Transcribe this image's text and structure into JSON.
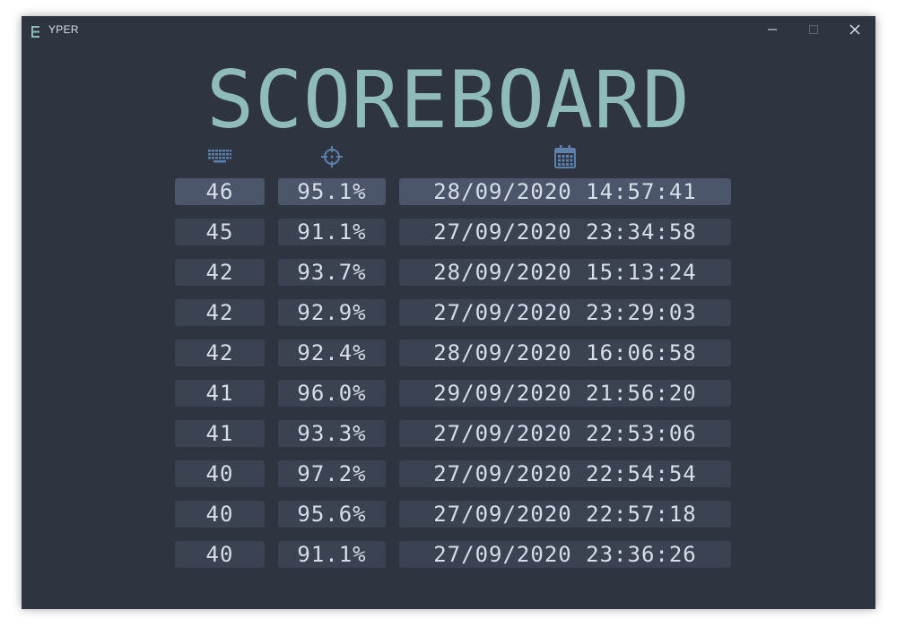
{
  "window": {
    "title": "YPER"
  },
  "heading": "SCOREBOARD",
  "columns": {
    "wpm_icon": "keyboard-icon",
    "accuracy_icon": "crosshair-icon",
    "date_icon": "calendar-icon"
  },
  "colors": {
    "background": "#2e3440",
    "accent": "#8fbcbb",
    "icon": "#5e81ac",
    "cell": "#3b4252",
    "cell_highlight": "#4c566a",
    "text": "#d8dee9"
  },
  "rows": [
    {
      "wpm": "46",
      "accuracy": "95.1%",
      "date": "28/09/2020 14:57:41"
    },
    {
      "wpm": "45",
      "accuracy": "91.1%",
      "date": "27/09/2020 23:34:58"
    },
    {
      "wpm": "42",
      "accuracy": "93.7%",
      "date": "28/09/2020 15:13:24"
    },
    {
      "wpm": "42",
      "accuracy": "92.9%",
      "date": "27/09/2020 23:29:03"
    },
    {
      "wpm": "42",
      "accuracy": "92.4%",
      "date": "28/09/2020 16:06:58"
    },
    {
      "wpm": "41",
      "accuracy": "96.0%",
      "date": "29/09/2020 21:56:20"
    },
    {
      "wpm": "41",
      "accuracy": "93.3%",
      "date": "27/09/2020 22:53:06"
    },
    {
      "wpm": "40",
      "accuracy": "97.2%",
      "date": "27/09/2020 22:54:54"
    },
    {
      "wpm": "40",
      "accuracy": "95.6%",
      "date": "27/09/2020 22:57:18"
    },
    {
      "wpm": "40",
      "accuracy": "91.1%",
      "date": "27/09/2020 23:36:26"
    }
  ]
}
